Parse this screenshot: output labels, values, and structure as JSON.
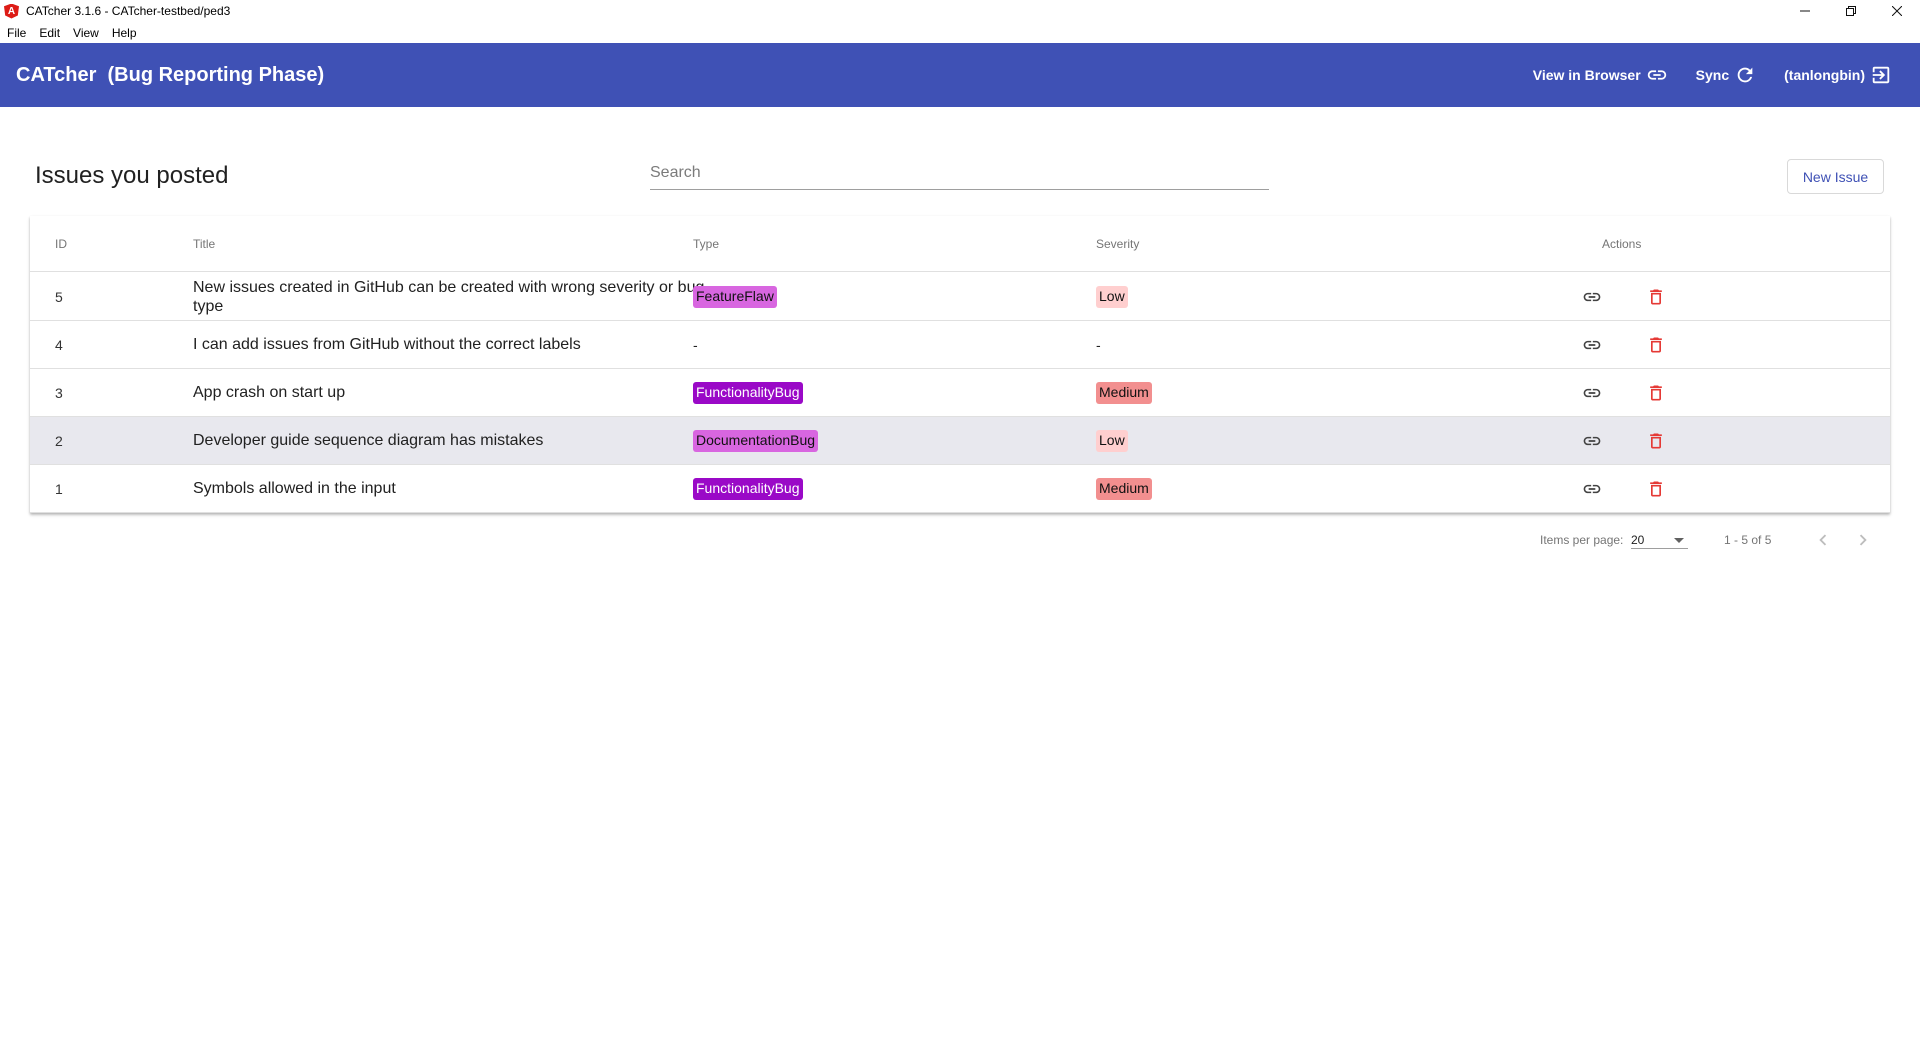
{
  "window": {
    "title": "CATcher 3.1.6 - CATcher-testbed/ped3",
    "icon": "angular-logo-icon",
    "controls": {
      "minimize": "—",
      "restore": "❐",
      "close": "✕"
    }
  },
  "menu": [
    "File",
    "Edit",
    "View",
    "Help"
  ],
  "toolbar": {
    "app_name": "CATcher  (Bug Reporting Phase)",
    "view_in_browser": "View in Browser",
    "sync": "Sync",
    "user": "(tanlongbin)",
    "background": "#3f51b5"
  },
  "header": {
    "title": "Issues you posted",
    "search_placeholder": "Search",
    "new_issue": "New Issue"
  },
  "table": {
    "columns": {
      "id": "ID",
      "title": "Title",
      "type": "Type",
      "severity": "Severity",
      "actions": "Actions"
    },
    "rows": [
      {
        "id": "5",
        "title": "New issues created in GitHub can be created with wrong severity or bug type",
        "type": "FeatureFlaw",
        "severity": "Low"
      },
      {
        "id": "4",
        "title": "I can add issues from GitHub without the correct labels",
        "type": "-",
        "severity": "-"
      },
      {
        "id": "3",
        "title": "App crash on start up",
        "type": "FunctionalityBug",
        "severity": "Medium"
      },
      {
        "id": "2",
        "title": "Developer guide sequence diagram has mistakes",
        "type": "DocumentationBug",
        "severity": "Low"
      },
      {
        "id": "1",
        "title": "Symbols allowed in the input",
        "type": "FunctionalityBug",
        "severity": "Medium"
      }
    ],
    "highlighted_row_id": "2"
  },
  "label_colors": {
    "FeatureFlaw": {
      "bg": "#d866e0",
      "fg": "#111111"
    },
    "FunctionalityBug": {
      "bg": "#9a09c7",
      "fg": "#ffffff"
    },
    "DocumentationBug": {
      "bg": "#d866e0",
      "fg": "#111111"
    },
    "Low": {
      "bg": "#ffcfcf",
      "fg": "#111111"
    },
    "Medium": {
      "bg": "#f28f8f",
      "fg": "#111111"
    }
  },
  "paginator": {
    "items_per_page_label": "Items per page:",
    "page_size": "20",
    "range": "1 - 5 of 5"
  }
}
